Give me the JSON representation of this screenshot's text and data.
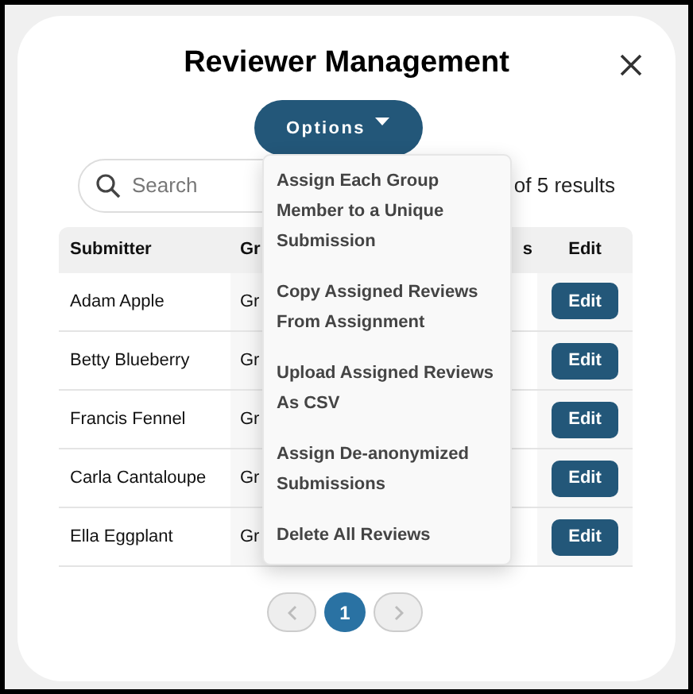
{
  "dialog": {
    "title": "Reviewer Management",
    "options_button": "Options",
    "expanded": true
  },
  "search": {
    "placeholder": "Search"
  },
  "results": "of 5 results",
  "menu": [
    "Assign Each Group Member to a Unique Submission",
    "Copy Assigned Reviews From Assignment",
    "Upload Assigned Reviews As CSV",
    "Assign De-anonymized Submissions",
    "Delete All Reviews"
  ],
  "table": {
    "columns": [
      "Submitter",
      "Gr",
      "s",
      "Edit"
    ],
    "rows": [
      {
        "submitter": "Adam Apple",
        "column_2": "Gr",
        "edit": "Edit"
      },
      {
        "submitter": "Betty Blueberry",
        "column_2": "Gr",
        "edit": "Edit"
      },
      {
        "submitter": "Francis Fennel",
        "column_2": "Gr",
        "edit": "Edit"
      },
      {
        "submitter": "Carla Cantaloupe",
        "column_2": "Gr",
        "edit": "Edit"
      },
      {
        "submitter": "Ella Eggplant",
        "column_2": "Gr",
        "edit": "Edit"
      }
    ]
  },
  "pagination": {
    "pages": [
      {
        "label": "1",
        "selected": true
      }
    ]
  }
}
